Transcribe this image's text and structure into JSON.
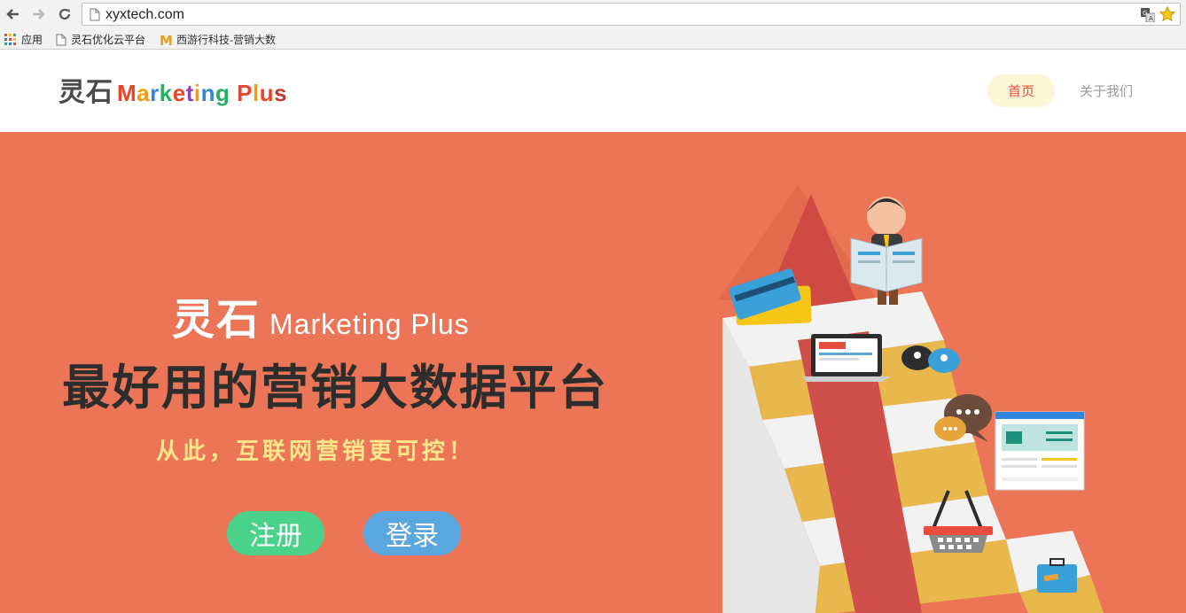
{
  "browser": {
    "url": "xyxtech.com",
    "bookmarks": [
      {
        "label": "应用",
        "icon": "apps-grid-icon"
      },
      {
        "label": "灵石优化云平台",
        "icon": "page-icon"
      },
      {
        "label": "西游行科技-营销大数",
        "icon": "m-logo-icon"
      }
    ]
  },
  "header": {
    "logo_cn": "灵石",
    "logo_en_letters": [
      {
        "t": "M",
        "c": "#e8442a"
      },
      {
        "t": "a",
        "c": "#f39c12"
      },
      {
        "t": "r",
        "c": "#2e86de"
      },
      {
        "t": "k",
        "c": "#27ae60"
      },
      {
        "t": "e",
        "c": "#e8442a"
      },
      {
        "t": "t",
        "c": "#8e44ad"
      },
      {
        "t": "i",
        "c": "#f39c12"
      },
      {
        "t": "n",
        "c": "#2e86de"
      },
      {
        "t": "g",
        "c": "#27ae60"
      },
      {
        "t": " ",
        "c": "#000000"
      },
      {
        "t": "P",
        "c": "#e8442a"
      },
      {
        "t": "l",
        "c": "#f39c12"
      },
      {
        "t": "u",
        "c": "#e8442a"
      },
      {
        "t": "s",
        "c": "#c0392b"
      }
    ],
    "nav": {
      "home": "首页",
      "about": "关于我们"
    }
  },
  "hero": {
    "brand_cn": "灵石",
    "brand_en": "Marketing Plus",
    "title": "最好用的营销大数据平台",
    "subtitle": "从此，互联网营销更可控！",
    "register": "注册",
    "login": "登录"
  },
  "colors": {
    "hero_bg": "#eb7556",
    "register_btn": "#4bd28a",
    "login_btn": "#5aa7e0",
    "subtitle": "#fde78a",
    "nav_active": "#e74c3c"
  }
}
